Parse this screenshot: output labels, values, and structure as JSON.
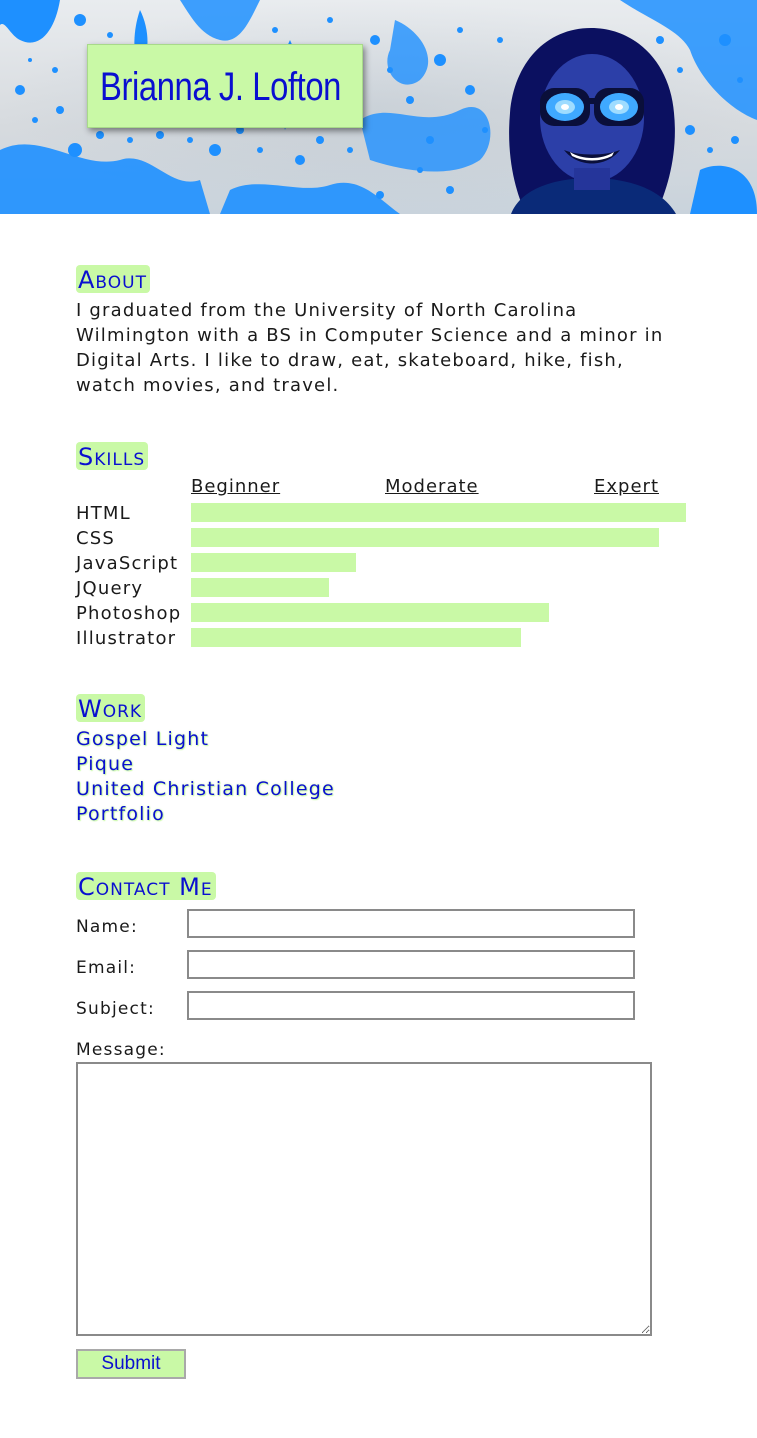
{
  "header": {
    "name": "Brianna J. Lofton"
  },
  "about": {
    "title": "About",
    "text": "I graduated from the University of North Carolina Wilmington with a BS in Computer Science and a minor in Digital Arts. I like to draw, eat, skateboard, hike, fish, watch movies, and travel."
  },
  "skills": {
    "title": "Skills",
    "scale": {
      "beginner": "Beginner",
      "moderate": "Moderate",
      "expert": "Expert"
    },
    "items": [
      {
        "name": "HTML",
        "level": 1.0
      },
      {
        "name": "CSS",
        "level": 0.945
      },
      {
        "name": "JavaScript",
        "level": 0.333
      },
      {
        "name": "JQuery",
        "level": 0.279
      },
      {
        "name": "Photoshop",
        "level": 0.723
      },
      {
        "name": "Illustrator",
        "level": 0.667
      }
    ]
  },
  "work": {
    "title": "Work",
    "links": [
      "Gospel Light",
      "Pique",
      "United Christian College",
      "Portfolio"
    ]
  },
  "contact": {
    "title": "Contact Me",
    "name_label": "Name:",
    "email_label": "Email:",
    "subject_label": "Subject:",
    "message_label": "Message:",
    "name_value": "",
    "email_value": "",
    "subject_value": "",
    "message_value": "",
    "submit_label": "Submit"
  },
  "colors": {
    "accent_green": "#c9f9a6",
    "link_blue": "#0a0fd0",
    "splash_blue": "#1e90ff"
  }
}
